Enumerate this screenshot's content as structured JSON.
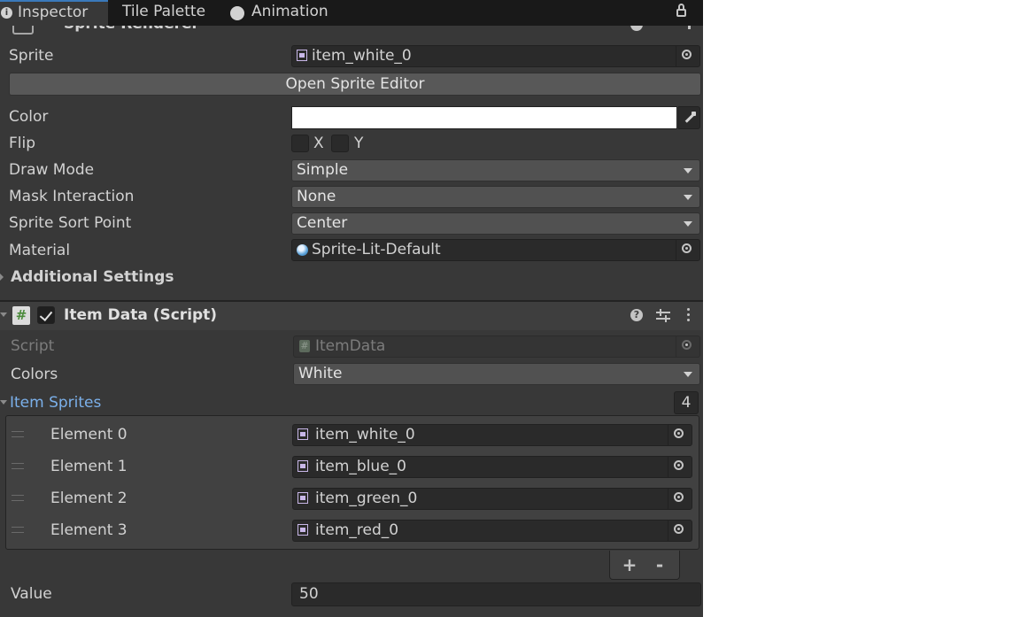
{
  "tabs": [
    {
      "label": "Inspector",
      "icon": "info-icon"
    },
    {
      "label": "Tile Palette"
    },
    {
      "label": "Animation",
      "icon": "clock-icon"
    }
  ],
  "sprite_renderer": {
    "header_title": "Sprite Renderer",
    "sprite": {
      "label": "Sprite",
      "value": "item_white_0"
    },
    "open_sprite_editor": "Open Sprite Editor",
    "color": {
      "label": "Color",
      "value": "#ffffff"
    },
    "flip": {
      "label": "Flip",
      "x": "X",
      "y": "Y"
    },
    "draw_mode": {
      "label": "Draw Mode",
      "value": "Simple"
    },
    "mask_interaction": {
      "label": "Mask Interaction",
      "value": "None"
    },
    "sprite_sort_point": {
      "label": "Sprite Sort Point",
      "value": "Center"
    },
    "material": {
      "label": "Material",
      "value": "Sprite-Lit-Default"
    },
    "additional_settings": "Additional Settings"
  },
  "item_data": {
    "header_title": "Item Data (Script)",
    "script": {
      "label": "Script",
      "value": "ItemData"
    },
    "colors": {
      "label": "Colors",
      "value": "White"
    },
    "item_sprites": {
      "label": "Item Sprites",
      "count": "4",
      "elements": [
        {
          "label": "Element 0",
          "value": "item_white_0"
        },
        {
          "label": "Element 1",
          "value": "item_blue_0"
        },
        {
          "label": "Element 2",
          "value": "item_green_0"
        },
        {
          "label": "Element 3",
          "value": "item_red_0"
        }
      ],
      "add": "+",
      "remove": "-"
    },
    "value": {
      "label": "Value",
      "value": "50"
    }
  }
}
